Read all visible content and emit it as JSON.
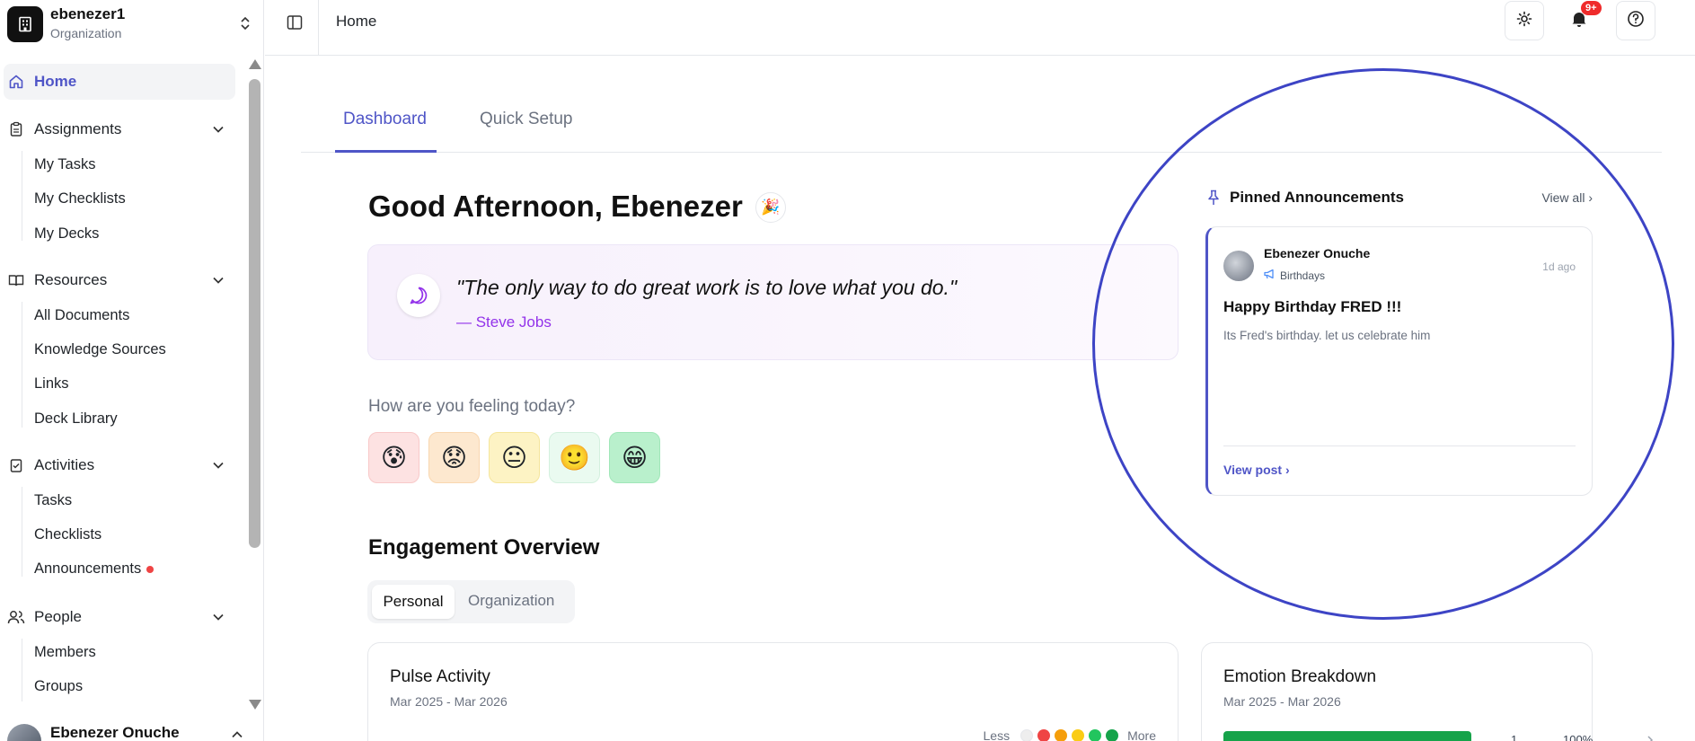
{
  "org": {
    "name": "ebenezer1",
    "subtitle": "Organization"
  },
  "sidebar": {
    "home": "Home",
    "groups": [
      {
        "label": "Assignments",
        "items": [
          "My Tasks",
          "My Checklists",
          "My Decks"
        ]
      },
      {
        "label": "Resources",
        "items": [
          "All Documents",
          "Knowledge Sources",
          "Links",
          "Deck Library"
        ]
      },
      {
        "label": "Activities",
        "items": [
          "Tasks",
          "Checklists",
          "Announcements"
        ]
      },
      {
        "label": "People",
        "items": [
          "Members",
          "Groups"
        ]
      }
    ],
    "user": {
      "name": "Ebenezer Onuche"
    }
  },
  "topbar": {
    "breadcrumb": "Home",
    "notification_badge": "9+"
  },
  "tabs": [
    "Dashboard",
    "Quick Setup"
  ],
  "greeting": "Good Afternoon, Ebenezer",
  "quote": {
    "text": "\"The only way to do great work is to love what you do.\"",
    "author": "— Steve Jobs"
  },
  "mood": {
    "question": "How are you feeling today?",
    "options": [
      {
        "emoji": "😰",
        "bg": "#fde2e2",
        "border": "#f8c9c9"
      },
      {
        "emoji": "😟",
        "bg": "#fde8cf",
        "border": "#f9d7b0"
      },
      {
        "emoji": "😐",
        "bg": "#fdf3c4",
        "border": "#f5e59c"
      },
      {
        "emoji": "🙂",
        "bg": "#eafaf0",
        "border": "#d3f0de"
      },
      {
        "emoji": "😁",
        "bg": "#b9f0cc",
        "border": "#a1e7b9"
      }
    ]
  },
  "engagement": {
    "title": "Engagement Overview",
    "segments": [
      "Personal",
      "Organization"
    ],
    "pulse": {
      "title": "Pulse Activity",
      "range": "Mar 2025 - Mar 2026",
      "legend_less": "Less",
      "legend_more": "More",
      "legend_colors": [
        "#eeeeee",
        "#ef4444",
        "#f59e0b",
        "#facc15",
        "#22c55e",
        "#15a34a"
      ]
    },
    "emotion": {
      "title": "Emotion Breakdown",
      "range": "Mar 2025 - Mar 2026",
      "rows": [
        {
          "emoji": "😁",
          "count": "1",
          "percent": "100%",
          "fraction": 1.0
        }
      ]
    }
  },
  "announcements": {
    "title": "Pinned Announcements",
    "view_all": "View all",
    "post": {
      "author": "Ebenezer Onuche",
      "category": "Birthdays",
      "time": "1d ago",
      "heading": "Happy Birthday FRED !!!",
      "body": "Its Fred's birthday. let us celebrate him",
      "link": "View post ›"
    }
  },
  "colors": {
    "accent": "#4f55c7",
    "highlight_ring": "#3d44c5",
    "quote_author": "#9333ea",
    "badge": "#ef2b2b"
  }
}
